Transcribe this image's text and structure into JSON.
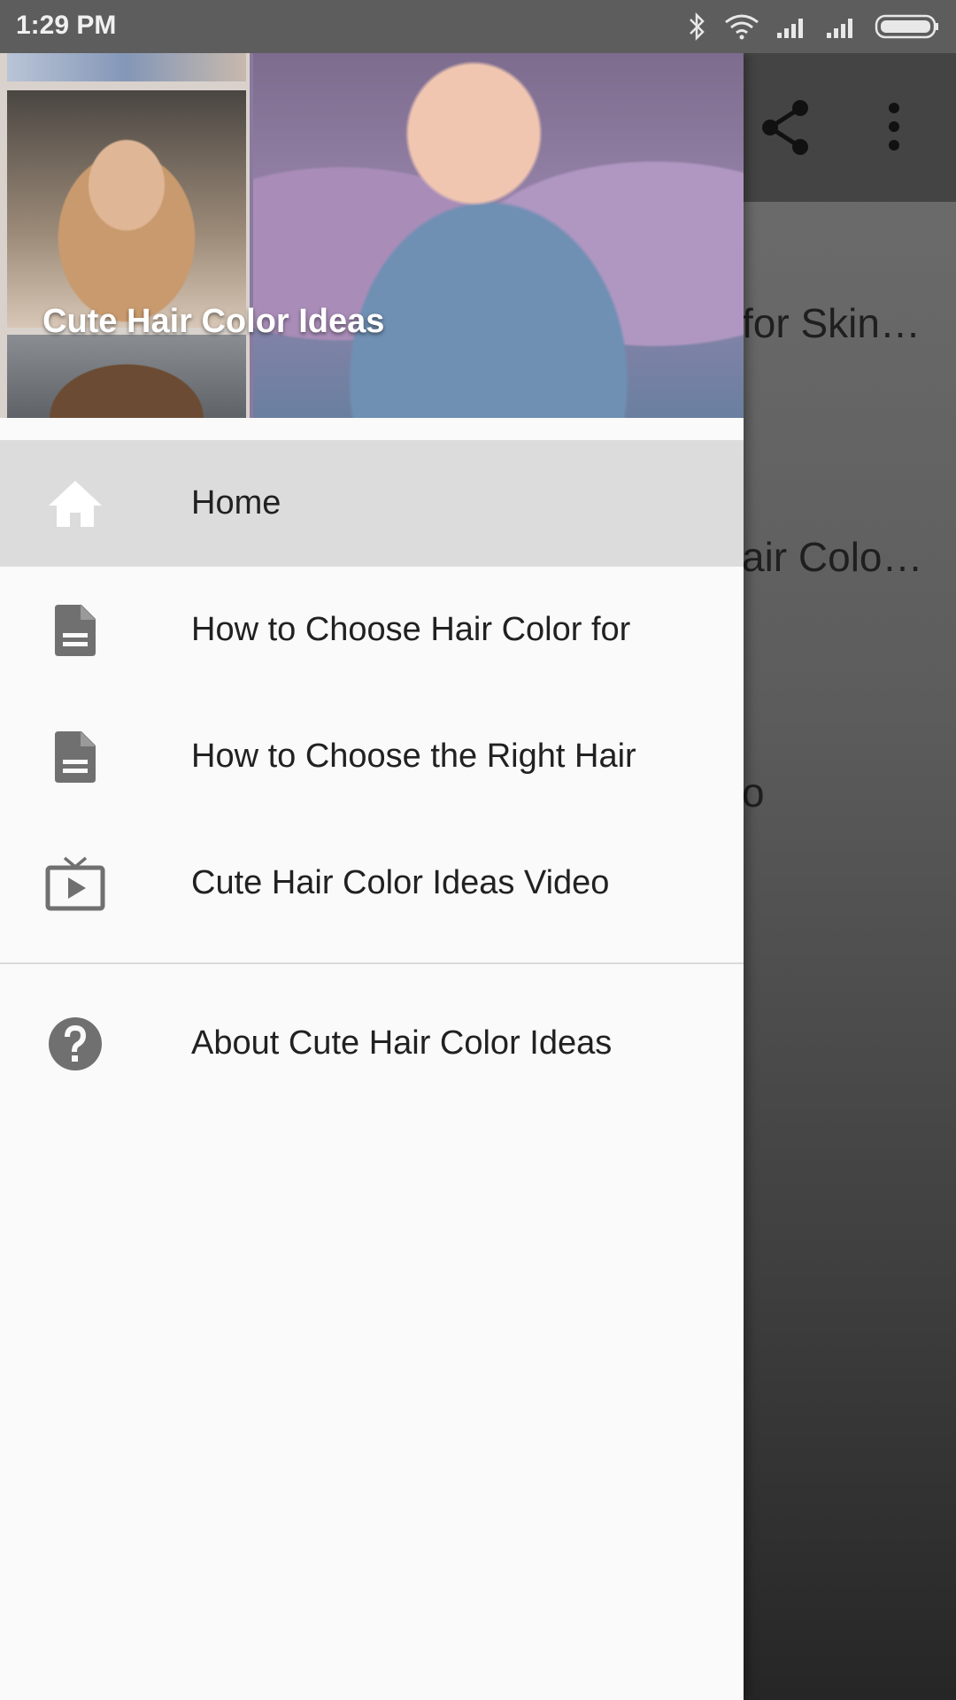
{
  "status_bar": {
    "time": "1:29 PM",
    "icons": [
      "bluetooth-icon",
      "wifi-icon",
      "signal-icon",
      "signal-icon",
      "battery-icon"
    ]
  },
  "background": {
    "toolbar_icons": [
      "share-icon",
      "more-vert-icon"
    ],
    "visible_text": [
      "for Skin…",
      "air Colo…",
      "o"
    ]
  },
  "drawer": {
    "header_title": "Cute Hair Color Ideas",
    "items": [
      {
        "label": "Home",
        "icon": "home-icon",
        "active": true
      },
      {
        "label": "How to Choose Hair Color for",
        "icon": "document-icon",
        "active": false
      },
      {
        "label": "How to Choose the Right Hair",
        "icon": "document-icon",
        "active": false
      },
      {
        "label": "Cute Hair Color Ideas Video",
        "icon": "tv-play-icon",
        "active": false
      }
    ],
    "secondary_items": [
      {
        "label": "About Cute Hair Color Ideas",
        "icon": "help-icon"
      }
    ]
  },
  "colors": {
    "drawer_bg": "#fafafa",
    "active_item_bg": "#dcdcdc",
    "icon_color": "#707070",
    "text_color": "#212121",
    "status_bar_bg": "#5d5d5d"
  }
}
